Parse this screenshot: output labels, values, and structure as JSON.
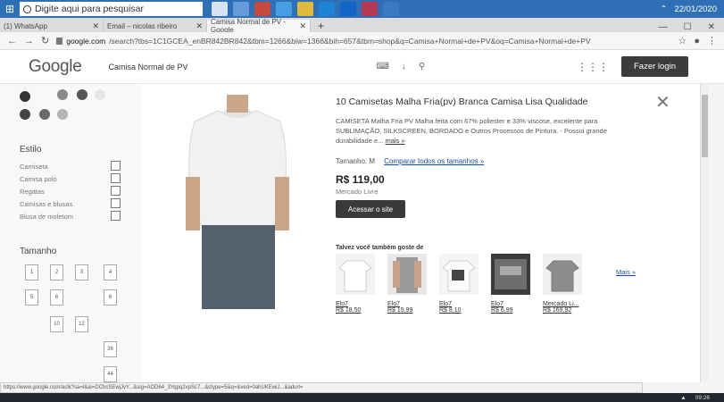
{
  "os": {
    "search_placeholder": "Digite aqui para pesquisar",
    "time": "09:26",
    "date": "22/01/2020"
  },
  "tabs": [
    {
      "label": "(1) WhatsApp"
    },
    {
      "label": "Email – nicolas ribeiro"
    },
    {
      "label": "Camisa Normal de PV - Google"
    }
  ],
  "address": {
    "host": "google.com",
    "path": "/search?tbs=1C1GCEA_enBR842BR842&tbm=1266&biw=1366&bih=657&tbm=shop&q=Camisa+Normal+de+PV&oq=Camisa+Normal+de+PV"
  },
  "header": {
    "logo": "Google",
    "query": "Camisa Normal de PV",
    "login_label": "Fazer login"
  },
  "sidebar": {
    "style_title": "Estilo",
    "styles": [
      "Camiseta",
      "Camisa polo",
      "Regatas",
      "Camisas e blusas",
      "Blusa de moletom"
    ],
    "size_title": "Tamanho",
    "sizes": [
      "1",
      "2",
      "3",
      "4",
      "5",
      "6",
      "6",
      "10",
      "12",
      "36",
      "44"
    ],
    "swatches": [
      "#333333",
      "#8a8a8a",
      "#555555",
      "#e5e5e5",
      "#444444",
      "#6a6a6a",
      "#b5b5b5"
    ]
  },
  "product": {
    "title": "10 Camisetas Malha Fria(pv) Branca Camisa Lisa Qualidade",
    "description": "CAMISETA Malha Fria PV Malha feita com 67% poliester e 33% viscose, excelente para SUBLIMAÇÃO, SILKSCREEN, BORDADO e Outros Processos de Pintura. - Possui grande durabilidade e...",
    "more_label": "mais »",
    "size_label": "Tamanho: M",
    "compare_label": "Comparar todos os tamanhos »",
    "price": "R$ 119,00",
    "store": "Mercado Livre",
    "visit_label": "Acessar o site"
  },
  "related": {
    "title": "Talvez você também goste de",
    "items": [
      {
        "store": "Elo7",
        "price": "R$ 18,50"
      },
      {
        "store": "Elo7",
        "price": "R$ 15,99"
      },
      {
        "store": "Elo7",
        "price": "R$ 8,10"
      },
      {
        "store": "Elo7",
        "price": "R$ 6,99"
      },
      {
        "store": "Mercado Li...",
        "price": "R$ 169,92"
      }
    ],
    "more_label": "Mais »"
  },
  "status_url": "https://www.google.com/aclk?sa=l&ai=DChcSEwjJvY...&sig=AOD64_3Yqpq2vpSc7...&ctype=5&q=&ved=0ahUKEwiJ...&adurl="
}
